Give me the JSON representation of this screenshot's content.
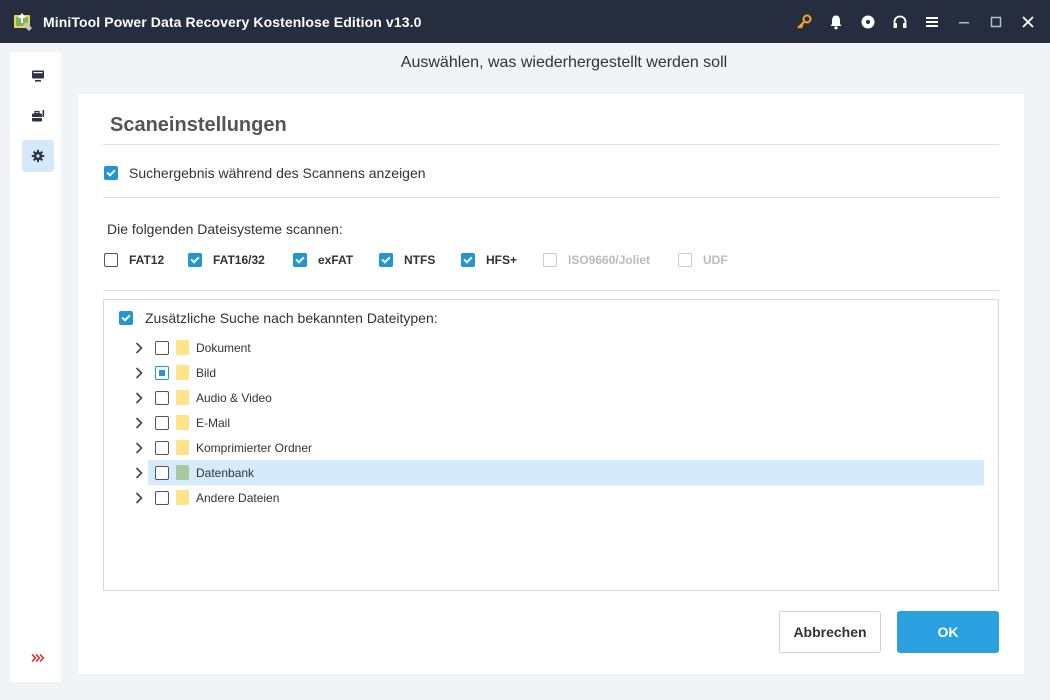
{
  "window": {
    "title": "MiniTool Power Data Recovery Kostenlose Edition v13.0"
  },
  "header": {
    "title": "Auswählen, was wiederhergestellt werden soll"
  },
  "panel": {
    "title": "Scaneinstellungen",
    "show_results_label": "Suchergebnis während des Scannens anzeigen",
    "show_results_checked": true,
    "fs_heading": "Die folgenden Dateisysteme scannen:",
    "filesystems": [
      {
        "label": "FAT12",
        "checked": false,
        "disabled": false
      },
      {
        "label": "FAT16/32",
        "checked": true,
        "disabled": false
      },
      {
        "label": "exFAT",
        "checked": true,
        "disabled": false
      },
      {
        "label": "NTFS",
        "checked": true,
        "disabled": false
      },
      {
        "label": "HFS+",
        "checked": true,
        "disabled": false
      },
      {
        "label": "ISO9660/Joliet",
        "checked": false,
        "disabled": true
      },
      {
        "label": "UDF",
        "checked": false,
        "disabled": true
      }
    ],
    "extra_search_label": "Zusätzliche Suche nach bekannten Dateitypen:",
    "extra_search_checked": true,
    "file_types": [
      {
        "label": "Dokument",
        "state": "unchecked",
        "folder_color": "#fde38a",
        "selected": false
      },
      {
        "label": "Bild",
        "state": "partial",
        "folder_color": "#fde38a",
        "selected": false
      },
      {
        "label": "Audio & Video",
        "state": "unchecked",
        "folder_color": "#fde38a",
        "selected": false
      },
      {
        "label": "E-Mail",
        "state": "unchecked",
        "folder_color": "#fde38a",
        "selected": false
      },
      {
        "label": "Komprimierter Ordner",
        "state": "unchecked",
        "folder_color": "#fde38a",
        "selected": false
      },
      {
        "label": "Datenbank",
        "state": "unchecked",
        "folder_color": "#a8c8a0",
        "selected": true
      },
      {
        "label": "Andere Dateien",
        "state": "unchecked",
        "folder_color": "#fde38a",
        "selected": false
      }
    ]
  },
  "buttons": {
    "cancel_label": "Abbrechen",
    "ok_label": "OK"
  },
  "colors": {
    "titlebar": "#262d3f",
    "accent": "#2196d3",
    "ok_button": "#2aa0e0",
    "key_icon": "#f5a623"
  }
}
